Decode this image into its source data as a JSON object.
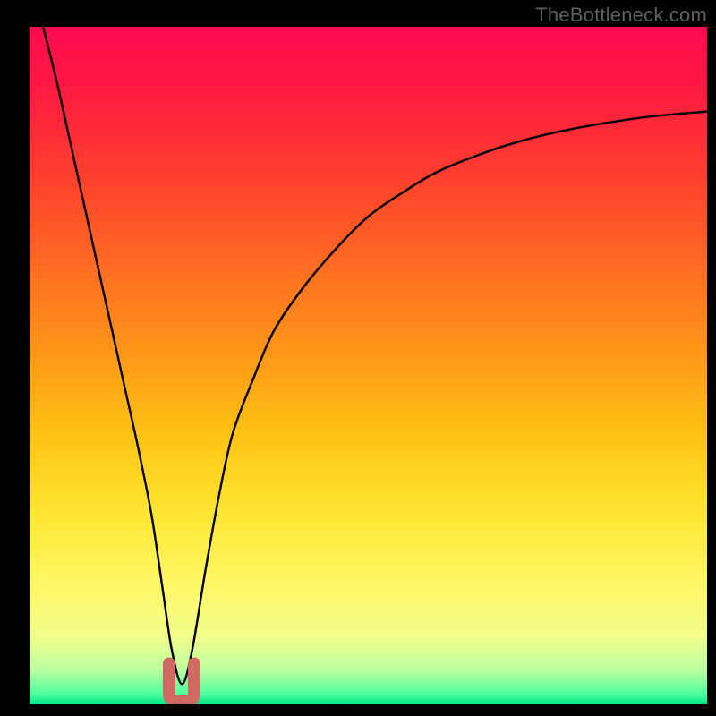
{
  "watermark": "TheBottleneck.com",
  "colors": {
    "black": "#000000",
    "frame_inner": "#000000",
    "watermark_text": "#5f5f5f",
    "curve": "#000000",
    "minimum_marker": "#cf6a63"
  },
  "gradient_stops": [
    {
      "offset": 0.0,
      "color": "#ff0a51"
    },
    {
      "offset": 0.1,
      "color": "#ff1c3f"
    },
    {
      "offset": 0.22,
      "color": "#ff3f2e"
    },
    {
      "offset": 0.35,
      "color": "#ff6a22"
    },
    {
      "offset": 0.48,
      "color": "#ff9617"
    },
    {
      "offset": 0.6,
      "color": "#ffc214"
    },
    {
      "offset": 0.72,
      "color": "#ffe733"
    },
    {
      "offset": 0.82,
      "color": "#fff765"
    },
    {
      "offset": 0.9,
      "color": "#f2ff8a"
    },
    {
      "offset": 0.95,
      "color": "#baffa0"
    },
    {
      "offset": 0.985,
      "color": "#4dff9d"
    },
    {
      "offset": 1.0,
      "color": "#00e28a"
    }
  ],
  "chart_data": {
    "type": "line",
    "title": "",
    "xlabel": "",
    "ylabel": "",
    "xlim": [
      0,
      100
    ],
    "ylim": [
      0,
      100
    ],
    "grid": false,
    "series": [
      {
        "name": "bottleneck_curve",
        "x": [
          2,
          4,
          6,
          8,
          10,
          12,
          14,
          16,
          18,
          19.5,
          21,
          22.5,
          24,
          26,
          28,
          30,
          33,
          36,
          40,
          45,
          50,
          55,
          60,
          66,
          72,
          78,
          85,
          92,
          100
        ],
        "y": [
          100,
          92,
          83,
          74,
          65,
          56,
          47,
          38,
          28,
          18,
          8,
          3,
          8,
          20,
          31,
          40,
          48,
          55,
          61,
          67,
          72,
          75.5,
          78.5,
          81,
          83,
          84.5,
          85.8,
          86.8,
          87.5
        ]
      }
    ],
    "minimum_region": {
      "x_range": [
        20.6,
        24.3
      ],
      "peak_x": 22.5,
      "peak_y": 3
    },
    "legend": []
  }
}
